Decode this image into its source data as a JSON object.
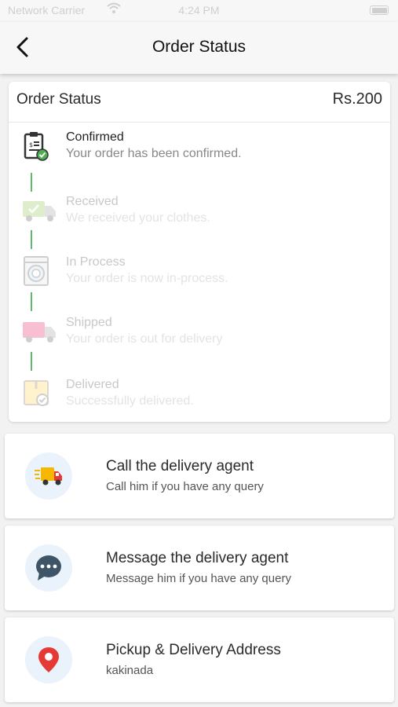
{
  "status_bar": {
    "carrier": "Network Carrier",
    "time": "4:24 PM"
  },
  "nav": {
    "title": "Order Status"
  },
  "card": {
    "title": "Order Status",
    "price": "Rs.200"
  },
  "steps": [
    {
      "title": "Confirmed",
      "desc": "Your order has been confirmed.",
      "icon": "clipboard-check-icon",
      "active": true
    },
    {
      "title": "Received",
      "desc": "We received your clothes.",
      "icon": "truck-check-icon",
      "active": false
    },
    {
      "title": "In Process",
      "desc": "Your order is now in-process.",
      "icon": "washing-machine-icon",
      "active": false
    },
    {
      "title": "Shipped",
      "desc": "Your order is out for delivery",
      "icon": "delivery-truck-icon",
      "active": false
    },
    {
      "title": "Delivered",
      "desc": "Successfully delivered.",
      "icon": "package-check-icon",
      "active": false
    }
  ],
  "actions": [
    {
      "title": "Call the delivery agent",
      "subtitle": "Call him if you have any query",
      "icon": "fast-truck-icon"
    },
    {
      "title": "Message the delivery agent",
      "subtitle": "Message him if you have any query",
      "icon": "chat-bubble-icon"
    },
    {
      "title": "Pickup & Delivery Address",
      "subtitle": "kakinada",
      "icon": "location-pin-icon"
    }
  ],
  "colors": {
    "connector": "#5fb96a",
    "accent_green": "#4caf50",
    "pin_red": "#e53935",
    "chat_dark": "#3d5566",
    "truck_yellow": "#f5b700",
    "truck_red": "#e53935"
  }
}
